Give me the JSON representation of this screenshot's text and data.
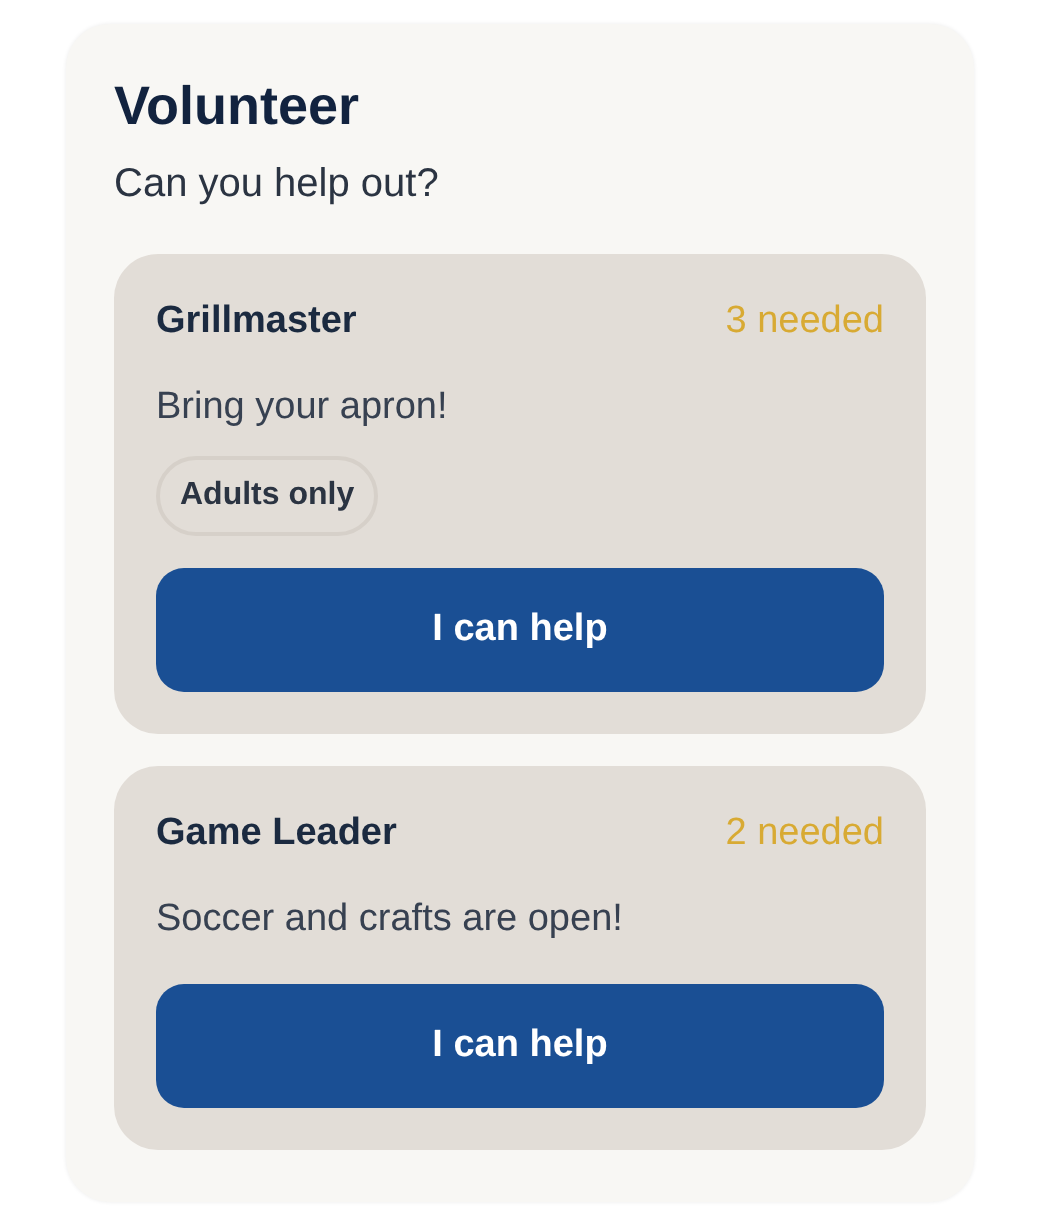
{
  "title": "Volunteer",
  "subtitle": "Can you help out?",
  "roles": [
    {
      "name": "Grillmaster",
      "needed": "3 needed",
      "note": "Bring your apron!",
      "tags": [
        "Adults only"
      ],
      "button": "I can help"
    },
    {
      "name": "Game Leader",
      "needed": "2 needed",
      "note": "Soccer and crafts are open!",
      "button": "I can help"
    }
  ]
}
